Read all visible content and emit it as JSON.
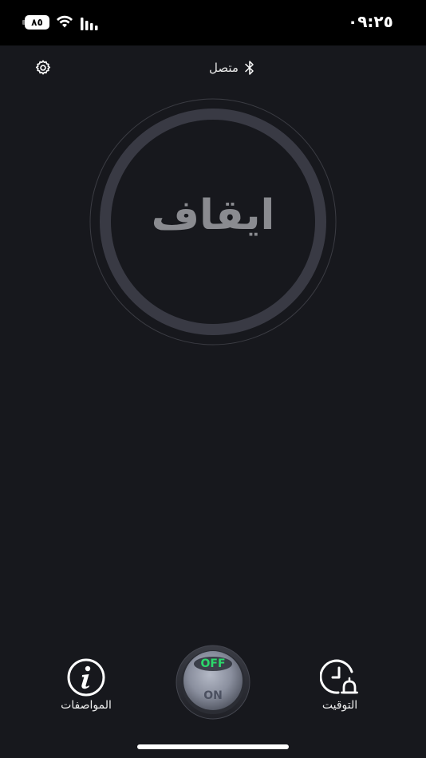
{
  "status_bar": {
    "time": "٠٩:٢٥",
    "battery_level": "٨٥",
    "signal_icon": "cellular-signal-icon",
    "wifi_icon": "wifi-icon"
  },
  "header": {
    "settings_icon": "gear-icon",
    "connection_status": "متصل",
    "bluetooth_icon": "bluetooth-icon"
  },
  "dial": {
    "state_label": "ايقاف"
  },
  "bottom_bar": {
    "specs_label": "المواصفات",
    "specs_icon": "info-icon",
    "timer_label": "التوقيت",
    "timer_icon": "clock-alarm-icon",
    "power_off_label": "OFF",
    "power_on_label": "ON"
  },
  "colors": {
    "background": "#17181d",
    "ring": "#3a3b45",
    "off_green": "#2bd96b"
  }
}
